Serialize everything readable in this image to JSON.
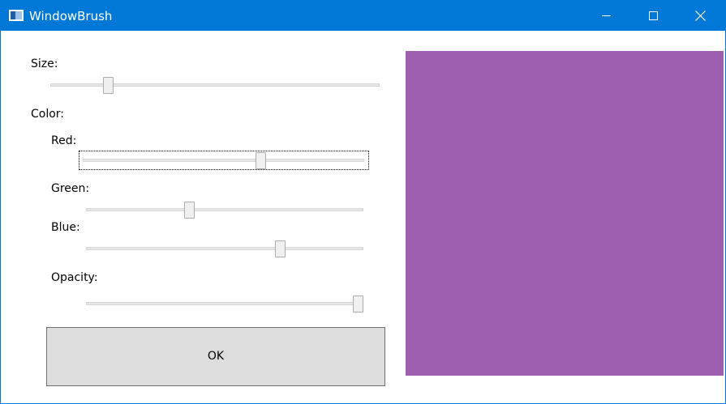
{
  "window": {
    "title": "WindowBrush",
    "accent_color": "#0078d7",
    "icons": {
      "app": "window-icon",
      "minimize": "minimize-icon",
      "maximize": "maximize-icon",
      "close": "close-icon"
    }
  },
  "size": {
    "label": "Size:",
    "value_fraction": 0.175
  },
  "color_section": {
    "label": "Color:"
  },
  "red": {
    "label": "Red:",
    "value_fraction": 0.63,
    "focused": true
  },
  "green": {
    "label": "Green:",
    "value_fraction": 0.37
  },
  "blue": {
    "label": "Blue:",
    "value_fraction": 0.7
  },
  "opacity": {
    "label": "Opacity:",
    "value_fraction": 1.0
  },
  "ok_button": {
    "label": "OK"
  },
  "preview": {
    "color": "#9f5fb0"
  }
}
